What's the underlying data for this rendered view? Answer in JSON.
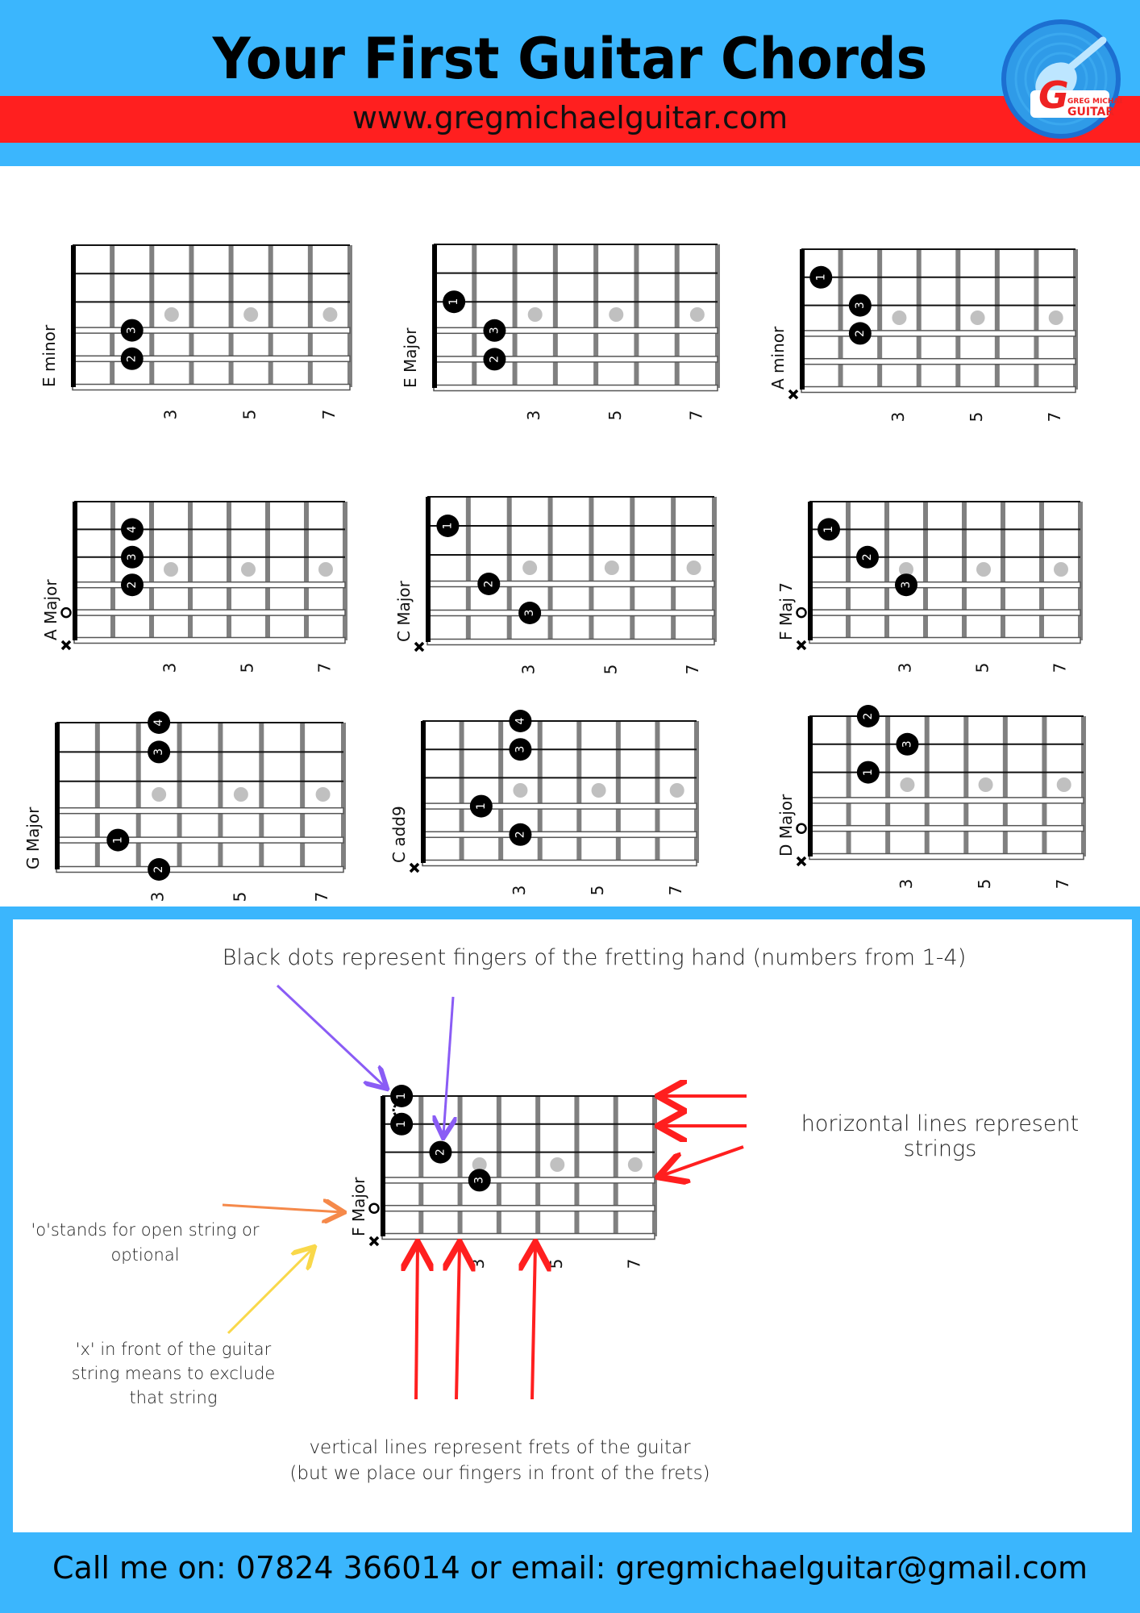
{
  "header": {
    "title": "Your First Guitar Chords",
    "website": "www.gregmichaelguitar.com",
    "logo": {
      "line1": "GREG MICHAEL",
      "line2": "GUITAR",
      "letter": "G",
      "icon": "guitar-logo-icon"
    }
  },
  "colors": {
    "sky_blue": "#3bb6fd",
    "banner_red": "#ff1f1f",
    "finger_dot": "#000000",
    "inlay_dot": "#c0c0c0",
    "fret_gray": "#808080",
    "arrow_purple": "#8a5cf5",
    "arrow_red": "#ff1f1f",
    "arrow_orange": "#f5894a",
    "arrow_yellow": "#f9d84a"
  },
  "fret_labels": [
    "3",
    "5",
    "7"
  ],
  "chords": [
    {
      "name": "E minor",
      "markers": [],
      "fingers": [
        {
          "string": 5,
          "fret": 2,
          "finger": "2"
        },
        {
          "string": 4,
          "fret": 2,
          "finger": "3"
        }
      ]
    },
    {
      "name": "E Major",
      "markers": [],
      "fingers": [
        {
          "string": 5,
          "fret": 2,
          "finger": "2"
        },
        {
          "string": 4,
          "fret": 2,
          "finger": "3"
        },
        {
          "string": 3,
          "fret": 1,
          "finger": "1"
        }
      ]
    },
    {
      "name": "A minor",
      "markers": [
        {
          "string": 6,
          "symbol": "x"
        }
      ],
      "fingers": [
        {
          "string": 4,
          "fret": 2,
          "finger": "2"
        },
        {
          "string": 3,
          "fret": 2,
          "finger": "3"
        },
        {
          "string": 2,
          "fret": 1,
          "finger": "1"
        }
      ]
    },
    {
      "name": "A Major",
      "markers": [
        {
          "string": 6,
          "symbol": "x"
        },
        {
          "string": 5,
          "symbol": "o"
        }
      ],
      "fingers": [
        {
          "string": 4,
          "fret": 2,
          "finger": "2"
        },
        {
          "string": 3,
          "fret": 2,
          "finger": "3"
        },
        {
          "string": 2,
          "fret": 2,
          "finger": "4"
        }
      ]
    },
    {
      "name": "C Major",
      "markers": [
        {
          "string": 6,
          "symbol": "x"
        }
      ],
      "fingers": [
        {
          "string": 5,
          "fret": 3,
          "finger": "3"
        },
        {
          "string": 4,
          "fret": 2,
          "finger": "2"
        },
        {
          "string": 2,
          "fret": 1,
          "finger": "1"
        }
      ]
    },
    {
      "name": "F Maj 7",
      "markers": [
        {
          "string": 6,
          "symbol": "x"
        },
        {
          "string": 5,
          "symbol": "o"
        }
      ],
      "fingers": [
        {
          "string": 4,
          "fret": 3,
          "finger": "3"
        },
        {
          "string": 3,
          "fret": 2,
          "finger": "2"
        },
        {
          "string": 2,
          "fret": 1,
          "finger": "1"
        }
      ]
    },
    {
      "name": "G Major",
      "markers": [],
      "fingers": [
        {
          "string": 6,
          "fret": 3,
          "finger": "2"
        },
        {
          "string": 5,
          "fret": 2,
          "finger": "1"
        },
        {
          "string": 2,
          "fret": 3,
          "finger": "3"
        },
        {
          "string": 1,
          "fret": 3,
          "finger": "4"
        }
      ]
    },
    {
      "name": "C add9",
      "markers": [
        {
          "string": 6,
          "symbol": "x"
        }
      ],
      "fingers": [
        {
          "string": 5,
          "fret": 3,
          "finger": "2"
        },
        {
          "string": 4,
          "fret": 2,
          "finger": "1"
        },
        {
          "string": 2,
          "fret": 3,
          "finger": "3"
        },
        {
          "string": 1,
          "fret": 3,
          "finger": "4"
        }
      ]
    },
    {
      "name": "D Major",
      "markers": [
        {
          "string": 6,
          "symbol": "x"
        },
        {
          "string": 5,
          "symbol": "o"
        }
      ],
      "fingers": [
        {
          "string": 3,
          "fret": 2,
          "finger": "1"
        },
        {
          "string": 2,
          "fret": 3,
          "finger": "3"
        },
        {
          "string": 1,
          "fret": 2,
          "finger": "2"
        }
      ]
    }
  ],
  "legend": {
    "example_chord": {
      "name": "F Major",
      "markers": [
        {
          "string": 6,
          "symbol": "x"
        },
        {
          "string": 5,
          "symbol": "o"
        }
      ],
      "fingers": [
        {
          "string": 1,
          "fret": 1,
          "finger": "1"
        },
        {
          "string": 2,
          "fret": 1,
          "finger": "1"
        },
        {
          "string": 3,
          "fret": 2,
          "finger": "2"
        },
        {
          "string": 4,
          "fret": 3,
          "finger": "3"
        }
      ]
    },
    "dots_note": "Black dots represent fingers of the fretting hand (numbers from 1-4)",
    "strings_note": "horizontal lines represent strings",
    "open_note": "'o'stands for open string or optional",
    "x_note": "'x' in front of the guitar string means to exclude that string",
    "frets_note_line1": "vertical lines represent frets of the guitar",
    "frets_note_line2": "(but we place our fingers in front of the frets)"
  },
  "footer": {
    "contact": "Call me on: 07824 366014 or email: gregmichaelguitar@gmail.com"
  }
}
